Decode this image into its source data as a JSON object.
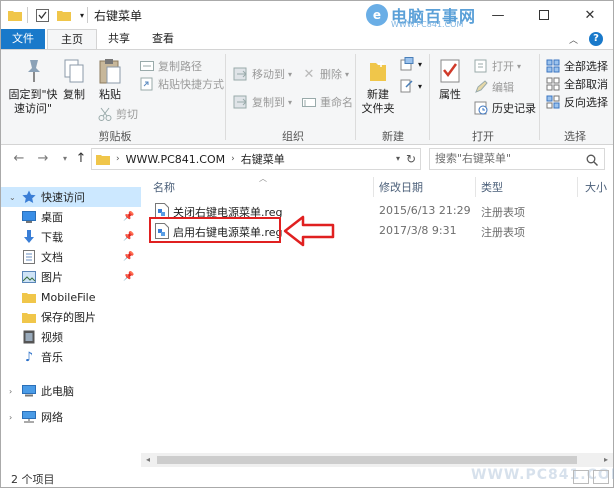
{
  "title": {
    "text": "右键菜单"
  },
  "logo": {
    "main": "电脑百事网",
    "sub": "WWW.PC841.COM"
  },
  "tabs": {
    "file": "文件",
    "home": "主页",
    "share": "共享",
    "view": "查看"
  },
  "ribbon": {
    "clipboard": {
      "pin": "固定到\"快\n速访问\"",
      "copy": "复制",
      "paste": "粘贴",
      "copy_path": "复制路径",
      "paste_shortcut": "粘贴快捷方式",
      "cut": "剪切",
      "label": "剪贴板"
    },
    "organize": {
      "move_to": "移动到",
      "copy_to": "复制到",
      "delete": "删除",
      "rename": "重命名",
      "label": "组织"
    },
    "new": {
      "new_folder": "新建\n文件夹",
      "label": "新建"
    },
    "open": {
      "properties": "属性",
      "open": "打开",
      "edit": "编辑",
      "history": "历史记录",
      "label": "打开"
    },
    "select": {
      "select_all": "全部选择",
      "select_none": "全部取消",
      "invert": "反向选择",
      "label": "选择"
    }
  },
  "address": {
    "crumbs": [
      "WWW.PC841.COM",
      "右键菜单"
    ],
    "search_placeholder": "搜索\"右键菜单\""
  },
  "nav": {
    "items": [
      {
        "label": "快速访问",
        "icon": "star-icon"
      },
      {
        "label": "桌面",
        "icon": "desktop-icon"
      },
      {
        "label": "下载",
        "icon": "download-icon"
      },
      {
        "label": "文档",
        "icon": "document-icon"
      },
      {
        "label": "图片",
        "icon": "pictures-icon"
      },
      {
        "label": "MobileFile",
        "icon": "folder-icon"
      },
      {
        "label": "保存的图片",
        "icon": "folder-icon"
      },
      {
        "label": "视频",
        "icon": "video-icon"
      },
      {
        "label": "音乐",
        "icon": "music-icon"
      },
      {
        "label": "此电脑",
        "icon": "computer-icon"
      },
      {
        "label": "网络",
        "icon": "network-icon"
      }
    ]
  },
  "columns": {
    "name": "名称",
    "date": "修改日期",
    "type": "类型",
    "size": "大小"
  },
  "files": [
    {
      "name": "关闭右键电源菜单.reg",
      "date": "2015/6/13 21:29",
      "type": "注册表项"
    },
    {
      "name": "启用右键电源菜单.reg",
      "date": "2017/3/8 9:31",
      "type": "注册表项"
    }
  ],
  "status": {
    "text": "2 个项目"
  },
  "colors": {
    "accent": "#1979ca",
    "highlight": "#e02020",
    "selected_nav": "#cce8ff"
  }
}
